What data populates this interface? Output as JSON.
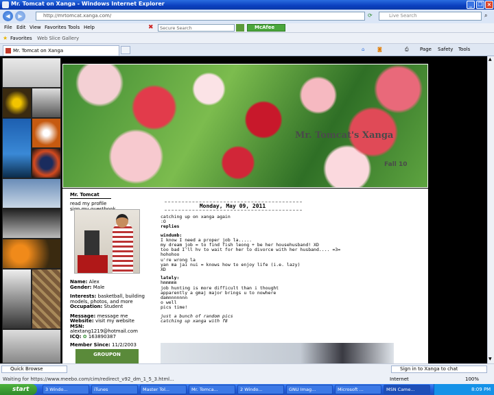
{
  "window": {
    "title": "Mr. Tomcat on Xanga - Windows Internet Explorer"
  },
  "address": {
    "url": "http://mrtomcat.xanga.com/",
    "search_placeholder": "Live Search"
  },
  "menu": {
    "items": [
      "File",
      "Edit",
      "View",
      "Favorites",
      "Tools",
      "Help"
    ],
    "secure_search_placeholder": "Secure Search",
    "mcafee_label": "McAfee"
  },
  "favorites": {
    "label": "Favorites",
    "web_slice": "Web Slice Gallery"
  },
  "tab": {
    "label": "Mr. Tomcat on Xanga"
  },
  "commands": {
    "page": "Page",
    "safety": "Safety",
    "tools": "Tools"
  },
  "banner": {
    "title": "Mr. Tomcat's Xanga",
    "subtitle": "Fall 10"
  },
  "profile": {
    "name_header": "Mr. Tomcat",
    "links": [
      "read my profile",
      "sign my guestbook"
    ],
    "name_label": "Name:",
    "name_value": "Alex",
    "gender_label": "Gender:",
    "gender_value": "Male",
    "interests_label": "Interests:",
    "interests_value": "basketball, building models, photos, and more",
    "occupation_label": "Occupation:",
    "occupation_value": "Student",
    "message_label": "Message:",
    "message_value": "message me",
    "website_label": "Website:",
    "website_value": "visit my website",
    "msn_label": "MSN:",
    "msn_value": "alextang1219@hotmail.com",
    "icq_label": "ICQ:",
    "icq_value": "163890387",
    "member_since_label": "Member Since:",
    "member_since_value": "11/2/2003",
    "ad_label": "GROUPON"
  },
  "post": {
    "date": "Monday, May 09, 2011",
    "lines": [
      "catching up on xanga again",
      ":O",
      "replies",
      "",
      "windumb:",
      "I know I need a proper job la.....",
      "my dream job = to find fish leong + be her househusband! XD",
      "too bad I'll hv to wait for her to divorce with her husband.... =3=",
      "hohohoo",
      "u're wrong la",
      "yan ma jai nui = knows how to enjoy life (i.e. lazy)",
      "XD",
      "",
      "lately:",
      "hmmmmm",
      "job hunting is more difficult than i thought",
      "apparently a gmaj major brings u to nowhere",
      "damnnnnnnn",
      "o well",
      "pics time!",
      "",
      "just a bunch of random pics",
      "catching up xanga with f8"
    ]
  },
  "statusbar": {
    "url": "Waiting for https://www.meebo.com/cim/redirect_v92_dm_1_5_3.html...",
    "zone": "Internet",
    "zoom": "100%",
    "quick_browse": "Quick Browse",
    "meebo": "Sign in to Xanga to chat"
  },
  "taskbar": {
    "start": "start",
    "tasks": [
      "3 Windo...",
      "iTunes",
      "Master Tol...",
      "Mr. Tomca...",
      "2 Windo...",
      "GNU Imag...",
      "Microsoft ...",
      "MSN Came..."
    ],
    "clock": "8:09 PM"
  }
}
